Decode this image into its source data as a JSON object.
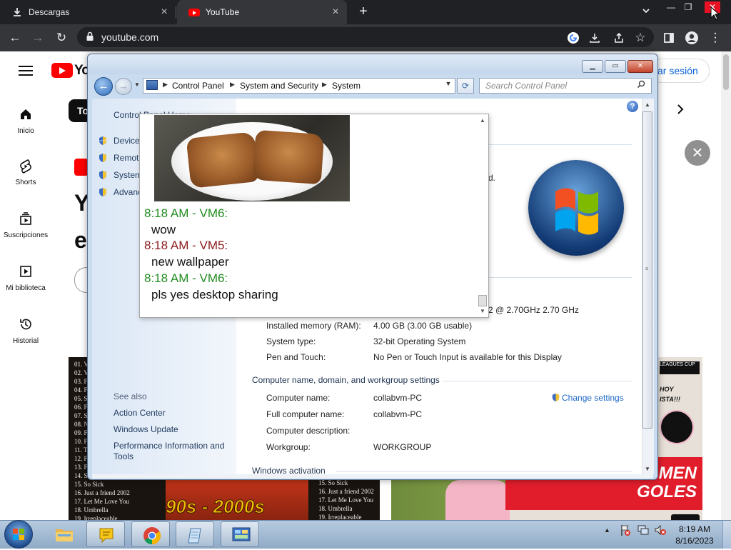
{
  "browser": {
    "tabs": [
      {
        "label": "Descargas",
        "icon": "download-icon",
        "active": false
      },
      {
        "label": "YouTube",
        "icon": "youtube-favicon-icon",
        "active": true
      }
    ],
    "url": "youtube.com"
  },
  "youtube": {
    "logo_text": "Yo",
    "sign_in": "ar sesión",
    "chip": "To",
    "nav": [
      {
        "label": "Inicio",
        "icon": "home-icon"
      },
      {
        "label": "Shorts",
        "icon": "shorts-icon"
      },
      {
        "label": "Suscripciones",
        "icon": "subscriptions-icon"
      },
      {
        "label": "Mi biblioteca",
        "icon": "library-icon"
      },
      {
        "label": "Historial",
        "icon": "history-icon"
      }
    ],
    "headline_1": "Y",
    "headline_2": "e",
    "thumb1": {
      "songs_left": [
        "01. V",
        "02. V",
        "03. F",
        "04. F",
        "05. S",
        "06. F",
        "07. S",
        "08. N",
        "09. F",
        "10. F",
        "11. T",
        "12. F",
        "13. F",
        "14. S",
        "15. So Sick",
        "16. Just a friend 2002",
        "17. Let Me Love You",
        "18. Umbrella",
        "19. Irreplaceable"
      ],
      "songs_right": [
        "15. So Sick",
        "16. Just a friend 2002",
        "17. Let Me Love You",
        "18. Umbrella",
        "19. Irreplaceable"
      ],
      "title_art": "90s - 2000s"
    },
    "thumb2": {
      "league": "LEAGUES CUP",
      "hoy": "HOY",
      "ista": "ISTA!!!",
      "men": "MEN",
      "goles": "GOLES"
    }
  },
  "control_panel": {
    "breadcrumbs": [
      "Control Panel",
      "System and Security",
      "System"
    ],
    "search_placeholder": "Search Control Panel",
    "nav_links": [
      "Control Panel Home",
      "Device",
      "Remot",
      "System",
      "Advanc"
    ],
    "see_also_heading": "See also",
    "see_also": [
      "Action Center",
      "Windows Update",
      "Performance Information and Tools"
    ],
    "partial_text": "d.",
    "processor_tail": "2 @ 2.70GHz   2.70 GHz",
    "system_rows": [
      {
        "label": "Installed memory (RAM):",
        "value": "4.00 GB (3.00 GB usable)"
      },
      {
        "label": "System type:",
        "value": "32-bit Operating System"
      },
      {
        "label": "Pen and Touch:",
        "value": "No Pen or Touch Input is available for this Display"
      }
    ],
    "computer_section": "Computer name, domain, and workgroup settings",
    "computer_rows": [
      {
        "label": "Computer name:",
        "value": "collabvm-PC"
      },
      {
        "label": "Full computer name:",
        "value": "collabvm-PC"
      },
      {
        "label": "Computer description:",
        "value": ""
      },
      {
        "label": "Workgroup:",
        "value": "WORKGROUP"
      }
    ],
    "change_settings": "Change settings",
    "activation_section": "Windows activation"
  },
  "chat": {
    "messages": [
      {
        "time": "8:18 AM - VM6:",
        "body": "wow",
        "color": "#228b22"
      },
      {
        "time": "8:18 AM - VM5:",
        "body": "new wallpaper",
        "color": "#8b1a1a"
      },
      {
        "time": "8:18 AM - VM6:",
        "body": "pls yes desktop sharing",
        "color": "#228b22"
      }
    ]
  },
  "taskbar": {
    "apps": [
      "explorer-icon",
      "messenger-icon",
      "chrome-icon",
      "notepad-icon",
      "control-panel-icon"
    ],
    "time": "8:19 AM",
    "date": "8/16/2023"
  }
}
